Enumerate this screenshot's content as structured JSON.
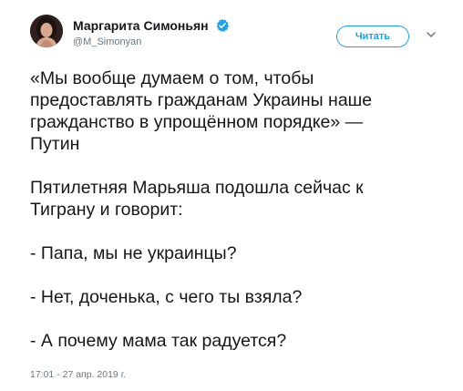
{
  "author": {
    "display_name": "Маргарита Симоньян",
    "handle": "@M_Simonyan",
    "verified": true,
    "avatar_icon": "profile-photo"
  },
  "actions": {
    "follow_label": "Читать",
    "more_icon": "chevron-down-icon",
    "accent_color": "#1da1f2"
  },
  "tweet": {
    "lines": [
      "«Мы вообще думаем о том, чтобы",
      "предоставлять гражданам Украины наше",
      "гражданство в упрощённом порядке» —",
      "Путин",
      "",
      "Пятилетняя Марьяша подошла сейчас к",
      "Тиграну и говорит:",
      "",
      "- Папа, мы не украинцы?",
      "",
      "- Нет, доченька, с чего ты взяла?",
      "",
      "- А почему мама так радуется?"
    ],
    "timestamp": "17:01 - 27 апр. 2019 г."
  }
}
